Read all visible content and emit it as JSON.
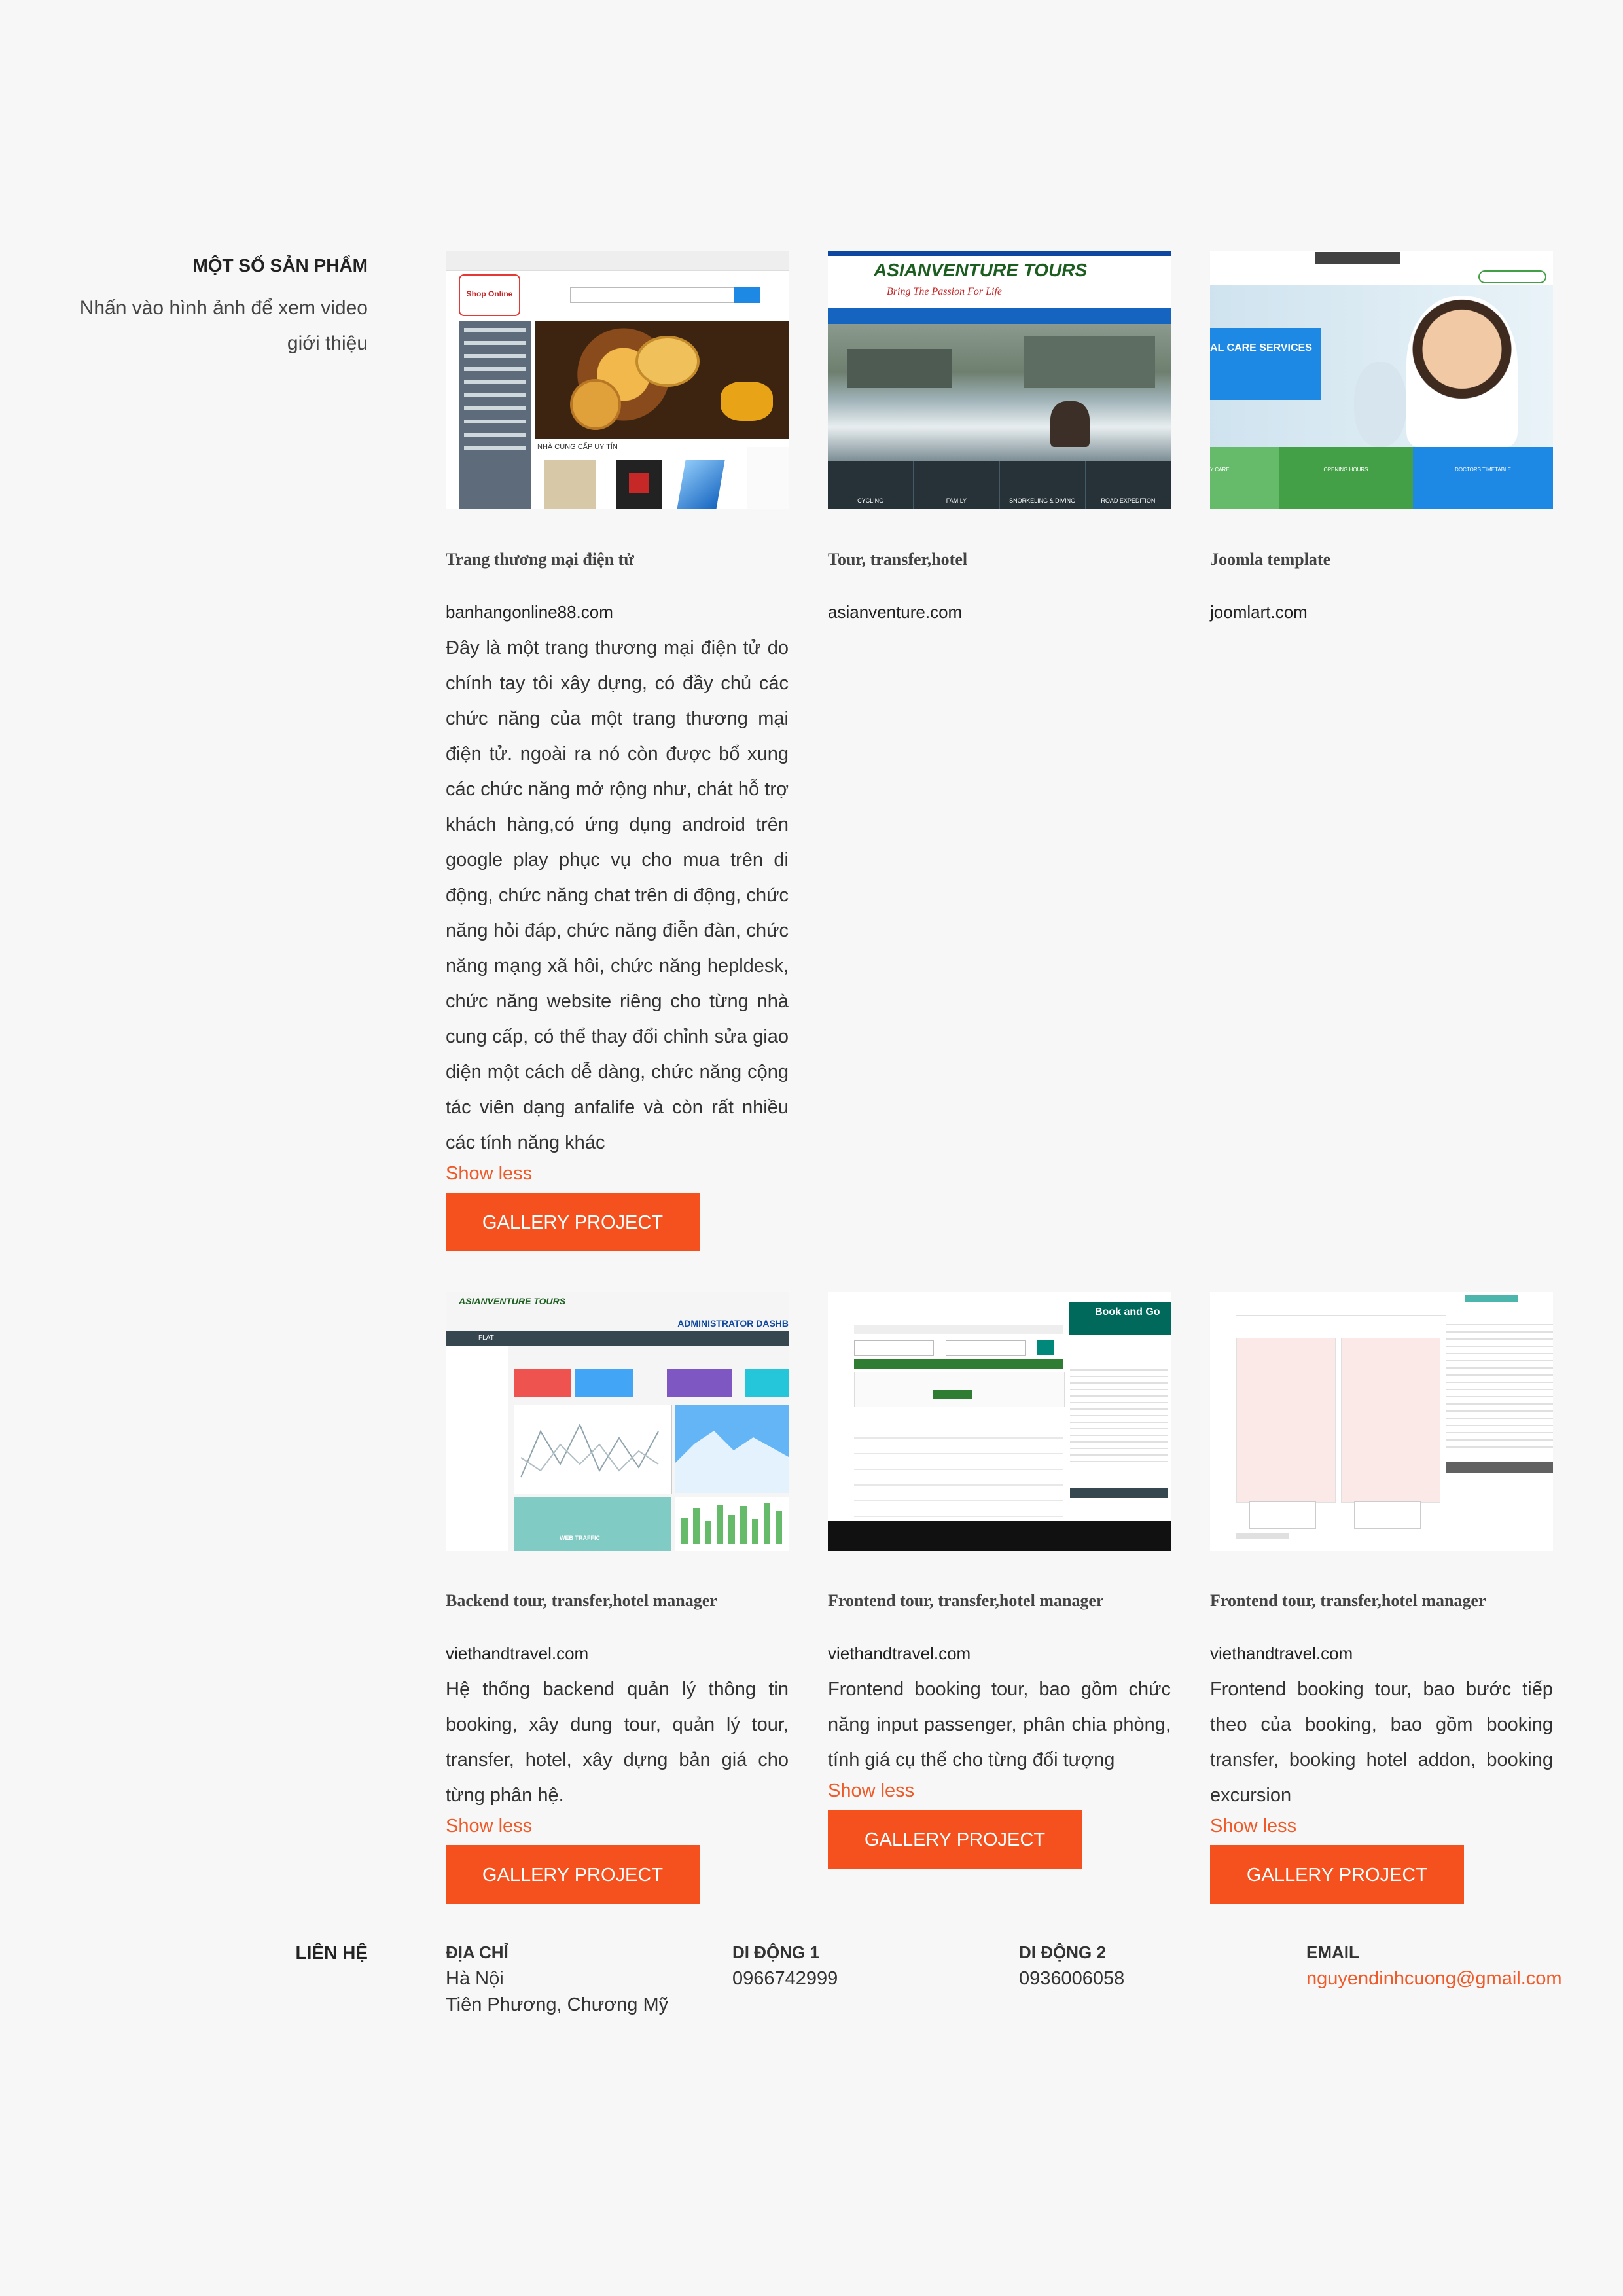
{
  "products": {
    "title": "MỘT SỐ SẢN PHẨM",
    "subtitle": "Nhấn vào hình ảnh để xem video giới thiệu",
    "show_less": "Show less",
    "gallery_label": "GALLERY PROJECT",
    "items": [
      {
        "title": "Trang thương mại điện tử",
        "site": "banhangonline88.com",
        "description": "Đây là một trang thương mại điện tử do chính tay tôi xây dựng, có đầy chủ các chức năng của một trang thương mại điện tử. ngoài ra nó còn được bổ xung các chức năng mở rộng như, chát hỗ trợ khách hàng,có ứng dụng android trên google play phục vụ cho mua trên di động, chức năng chat trên di động, chức năng hỏi đáp, chức năng điễn đàn, chức năng mạng xã hôi, chức năng hepldesk, chức năng website riêng cho từng nhà cung cấp, có thể thay đổi chỉnh sửa giao diện một cách dễ dàng, chức năng cộng tác viên dạng anfalife và còn rất nhiều các tính năng khác",
        "thumb_text": [
          "Shop Online",
          "NHÀ CUNG CẤP UY TÍN"
        ]
      },
      {
        "title": "Tour, transfer,hotel",
        "site": "asianventure.com",
        "thumb_text": [
          "ASIANVENTURE TOURS",
          "Bring The Passion For Life",
          "CYCLING",
          "FAMILY",
          "SNORKELING & DIVING",
          "ROAD EXPEDITION"
        ]
      },
      {
        "title": "Joomla template",
        "site": "joomlart.com",
        "thumb_text": [
          "AL CARE SERVICES",
          "Y CARE",
          "OPENING HOURS",
          "DOCTORS TIMETABLE"
        ]
      },
      {
        "title": "Backend tour, transfer,hotel manager",
        "site": "viethandtravel.com",
        "description": "Hệ thống backend quản lý thông tin booking, xây dung tour, quản lý tour, transfer, hotel, xây dựng bản giá cho từng phân hệ.",
        "thumb_text": [
          "ASIANVENTURE TOURS",
          "ADMINISTRATOR DASHB",
          "FLAT",
          "WEB TRAFFIC"
        ]
      },
      {
        "title": "Frontend tour, transfer,hotel manager",
        "site": "viethandtravel.com",
        "description": "Frontend booking tour, bao gồm chức năng input passenger, phân chia phòng, tính giá cụ thể cho từng đối tượng",
        "thumb_text": [
          "Book and Go"
        ]
      },
      {
        "title": "Frontend tour, transfer,hotel manager",
        "site": "viethandtravel.com",
        "description": "Frontend booking tour, bao bước tiếp theo của booking, bao gồm booking transfer, booking hotel addon, booking excursion",
        "thumb_text": []
      }
    ]
  },
  "contact": {
    "title": "LIÊN HỆ",
    "address_label": "ĐỊA CHỈ",
    "address_line1": "Hà Nội",
    "address_line2": "Tiên Phương, Chương Mỹ",
    "mobile1_label": "DI ĐỘNG 1",
    "mobile1": "0966742999",
    "mobile2_label": "DI ĐỘNG 2",
    "mobile2": "0936006058",
    "email_label": "EMAIL",
    "email": "nguyendinhcuong@gmail.com"
  },
  "colors": {
    "accent": "#f4511e",
    "link": "#f05a28",
    "background": "#f7f7f7"
  }
}
